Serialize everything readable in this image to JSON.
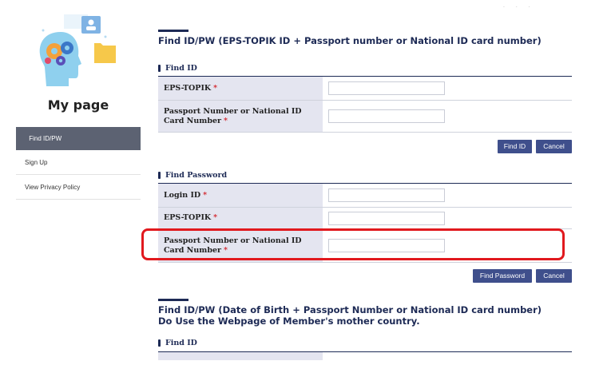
{
  "sidebar": {
    "title": "My page",
    "items": [
      {
        "label": "Find ID/PW",
        "active": true
      },
      {
        "label": "Sign Up",
        "active": false
      },
      {
        "label": "View Privacy Policy",
        "active": false
      }
    ]
  },
  "section1": {
    "title": "Find ID/PW (EPS-TOPIK ID + Passport number or National ID card number)",
    "find_id": {
      "heading": "Find ID",
      "fields": [
        {
          "label": "EPS-TOPIK",
          "required_mark": "*",
          "value": ""
        },
        {
          "label": "Passport Number or National ID Card Number",
          "required_mark": "*",
          "value": ""
        }
      ],
      "buttons": {
        "primary": "Find ID",
        "cancel": "Cancel"
      }
    },
    "find_password": {
      "heading": "Find Password",
      "fields": [
        {
          "label": "Login ID",
          "required_mark": "*",
          "value": ""
        },
        {
          "label": "EPS-TOPIK",
          "required_mark": "*",
          "value": ""
        },
        {
          "label": "Passport Number or National ID Card Number",
          "required_mark": "*",
          "value": ""
        }
      ],
      "buttons": {
        "primary": "Find Password",
        "cancel": "Cancel"
      }
    }
  },
  "section2": {
    "title_line1": "Find ID/PW (Date of Birth + Passport Number or National ID card number)",
    "title_line2": "Do Use the Webpage of Member's mother country.",
    "find_id": {
      "heading": "Find ID"
    }
  },
  "colors": {
    "navy": "#1d2a55",
    "button": "#3f4f8c",
    "label_bg": "#e4e5f0",
    "active_nav": "#5c6272",
    "required": "#d2232a",
    "highlight": "#e1191e"
  },
  "icons": [
    "head-gears-illustration-icon",
    "user-card-icon",
    "folder-icon"
  ]
}
